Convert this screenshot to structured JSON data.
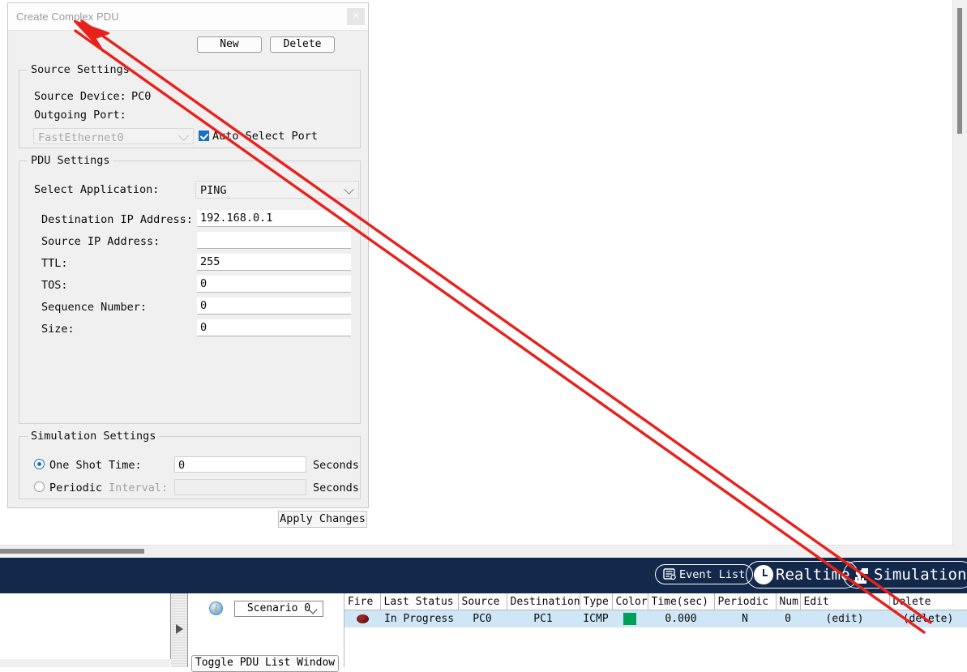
{
  "dialog": {
    "title": "Create Complex PDU",
    "close_label": "✕",
    "source_settings": {
      "legend": "Source Settings",
      "source_device_label": "Source Device:",
      "source_device_value": "PC0",
      "outgoing_port_label": "Outgoing Port:",
      "outgoing_port_value": "FastEthernet0",
      "auto_select_port_label": "Auto Select Port",
      "auto_select_port_checked": true
    },
    "pdu_settings": {
      "legend": "PDU Settings",
      "select_application_label": "Select Application:",
      "select_application_value": "PING",
      "fields": [
        {
          "label": "Destination IP Address:",
          "value": "192.168.0.1"
        },
        {
          "label": "Source IP Address:",
          "value": ""
        },
        {
          "label": "TTL:",
          "value": "255"
        },
        {
          "label": "TOS:",
          "value": "0"
        },
        {
          "label": "Sequence Number:",
          "value": "0"
        },
        {
          "label": "Size:",
          "value": "0"
        }
      ]
    },
    "simulation_settings": {
      "legend": "Simulation Settings",
      "one_shot_label": "One Shot",
      "one_shot_selected": true,
      "time_label": "Time:",
      "time_value": "0",
      "time_units": "Seconds",
      "periodic_label": "Periodic",
      "periodic_selected": false,
      "interval_label": "Interval:",
      "interval_value": "",
      "interval_units": "Seconds"
    },
    "apply_changes_label": "Apply Changes"
  },
  "bottom_bar": {
    "event_list_label": "Event List",
    "realtime_label": "Realtime",
    "simulation_label": "Simulation"
  },
  "scenario_panel": {
    "info_glyph": "i",
    "scenario_value": "Scenario 0",
    "new_label": "New",
    "delete_label": "Delete",
    "toggle_label": "Toggle PDU List Window"
  },
  "event_table": {
    "headers": [
      "Fire",
      "Last Status",
      "Source",
      "Destination",
      "Type",
      "Color",
      "Time(sec)",
      "Periodic",
      "Num",
      "Edit",
      "Delete"
    ],
    "rows": [
      {
        "fire": "fire-dot-icon",
        "last_status": "In Progress",
        "source": "PC0",
        "destination": "PC1",
        "type": "ICMP",
        "color": "#00a05a",
        "time_sec": "0.000",
        "periodic": "N",
        "num": "0",
        "edit": "(edit)",
        "delete": "(delete)"
      }
    ]
  },
  "colors": {
    "bottom_bar": "#13294b",
    "row_selected": "#cfe6f7",
    "accent_blue": "#1a6fc4",
    "annotation_red": "#e8211b",
    "packet_color": "#00a05a"
  }
}
